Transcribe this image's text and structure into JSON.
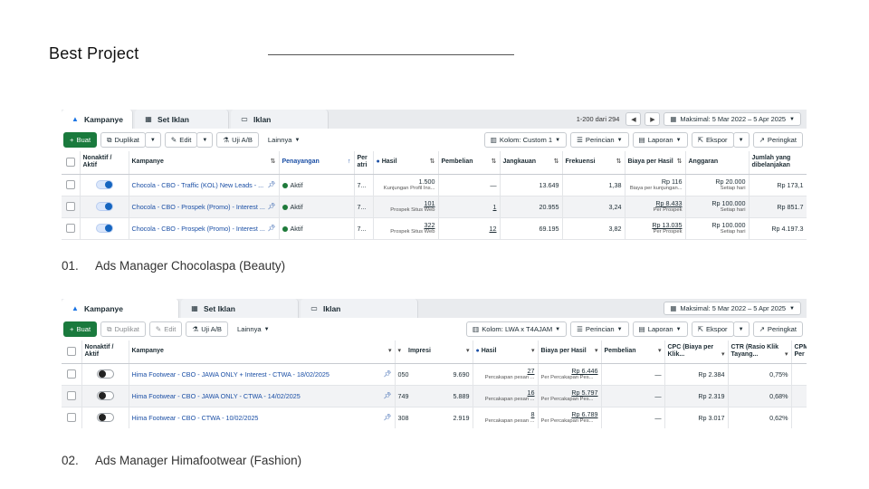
{
  "page": {
    "title": "Best Project"
  },
  "captions": [
    {
      "num": "01.",
      "text": "Ads Manager Chocolaspa (Beauty)"
    },
    {
      "num": "02.",
      "text": "Ads Manager Himafootwear (Fashion)"
    }
  ],
  "panel1": {
    "tabs": [
      "Kampanye",
      "Set Iklan",
      "Iklan"
    ],
    "pager_text": "1-200 dari 294",
    "date_label": "Maksimal: 5 Mar 2022 – 5 Apr 2025",
    "toolbar": {
      "create": "Buat",
      "duplicate": "Duplikat",
      "edit": "Edit",
      "abtest": "Uji A/B",
      "more": "Lainnya",
      "columns": "Kolom: Custom 1",
      "breakdown": "Perincian",
      "reports": "Laporan",
      "export": "Ekspor",
      "compare": "Peringkat"
    },
    "headers": [
      "Nonaktif / Aktif",
      "Kampanye",
      "Penayangan",
      "Per atri",
      "Hasil",
      "Pembelian",
      "Jangkauan",
      "Frekuensi",
      "Biaya per Hasil",
      "Anggaran",
      "Jumlah yang dibelanjakan"
    ],
    "rows": [
      {
        "name": "Chocola - CBO - Traffic (KOL) New Leads - ...",
        "delivery": "Aktif",
        "attr": "7...",
        "result": "1.500",
        "result_sub": "Kunjungan Profil Ins...",
        "purchase": "—",
        "reach": "13.649",
        "freq": "1,38",
        "cpr": "Rp 116",
        "cpr_sub": "Biaya per kunjungan...",
        "budget": "Rp 20.000",
        "budget_sub": "Setiap hari",
        "spent": "Rp 173,1"
      },
      {
        "name": "Chocola - CBO - Prospek (Promo) - Interest ...",
        "delivery": "Aktif",
        "attr": "7...",
        "result": "101",
        "result_sub": "Prospek Situs Web",
        "purchase": "1",
        "reach": "20.955",
        "freq": "3,24",
        "cpr": "Rp 8.433",
        "cpr_sub": "Per Prospek",
        "budget": "Rp 100.000",
        "budget_sub": "Setiap hari",
        "spent": "Rp 851.7"
      },
      {
        "name": "Chocola - CBO - Prospek (Promo) - Interest ...",
        "delivery": "Aktif",
        "attr": "7...",
        "result": "322",
        "result_sub": "Prospek Situs Web",
        "purchase": "12",
        "reach": "69.195",
        "freq": "3,82",
        "cpr": "Rp 13.035",
        "cpr_sub": "Per Prospek",
        "budget": "Rp 100.000",
        "budget_sub": "Setiap hari",
        "spent": "Rp 4.197.3"
      }
    ]
  },
  "panel2": {
    "tabs": [
      "Kampanye",
      "Set Iklan",
      "Iklan"
    ],
    "date_label": "Maksimal: 5 Mar 2022 – 5 Apr 2025",
    "toolbar": {
      "create": "Buat",
      "duplicate": "Duplikat",
      "edit": "Edit",
      "abtest": "Uji A/B",
      "more": "Lainnya",
      "columns": "Kolom: LWA x T4AJAM",
      "breakdown": "Perincian",
      "reports": "Laporan",
      "export": "Ekspor",
      "compare": "Peringkat"
    },
    "headers": [
      "Nonaktif / Aktif",
      "Kampanye",
      "Impresi",
      "Hasil",
      "Biaya per Hasil",
      "Pembelian",
      "CPC (Biaya per Klik...",
      "CTR (Rasio Klik Tayang...",
      "CPM Per"
    ],
    "rows": [
      {
        "name": "Hima Footwear - CBO - JAWA ONLY + Interest - CTWA - 18/02/2025",
        "cut": "050",
        "impr": "9.690",
        "result": "27",
        "result_sub": "Percakapan pesan ...",
        "cpr": "Rp 6.446",
        "cpr_sub": "Per Percakapan Pes...",
        "purchase": "—",
        "cpc": "Rp 2.384",
        "ctr": "0,75%"
      },
      {
        "name": "Hima Footwear - CBO - JAWA ONLY - CTWA - 14/02/2025",
        "cut": "749",
        "impr": "5.889",
        "result": "16",
        "result_sub": "Percakapan pesan ...",
        "cpr": "Rp 5.797",
        "cpr_sub": "Per Percakapan Pes...",
        "purchase": "—",
        "cpc": "Rp 2.319",
        "ctr": "0,68%"
      },
      {
        "name": "Hima Footwear - CBO - CTWA - 10/02/2025",
        "cut": "308",
        "impr": "2.919",
        "result": "8",
        "result_sub": "Percakapan pesan ...",
        "cpr": "Rp 6.789",
        "cpr_sub": "Per Percakapan Pes...",
        "purchase": "—",
        "cpc": "Rp 3.017",
        "ctr": "0,62%"
      }
    ]
  }
}
